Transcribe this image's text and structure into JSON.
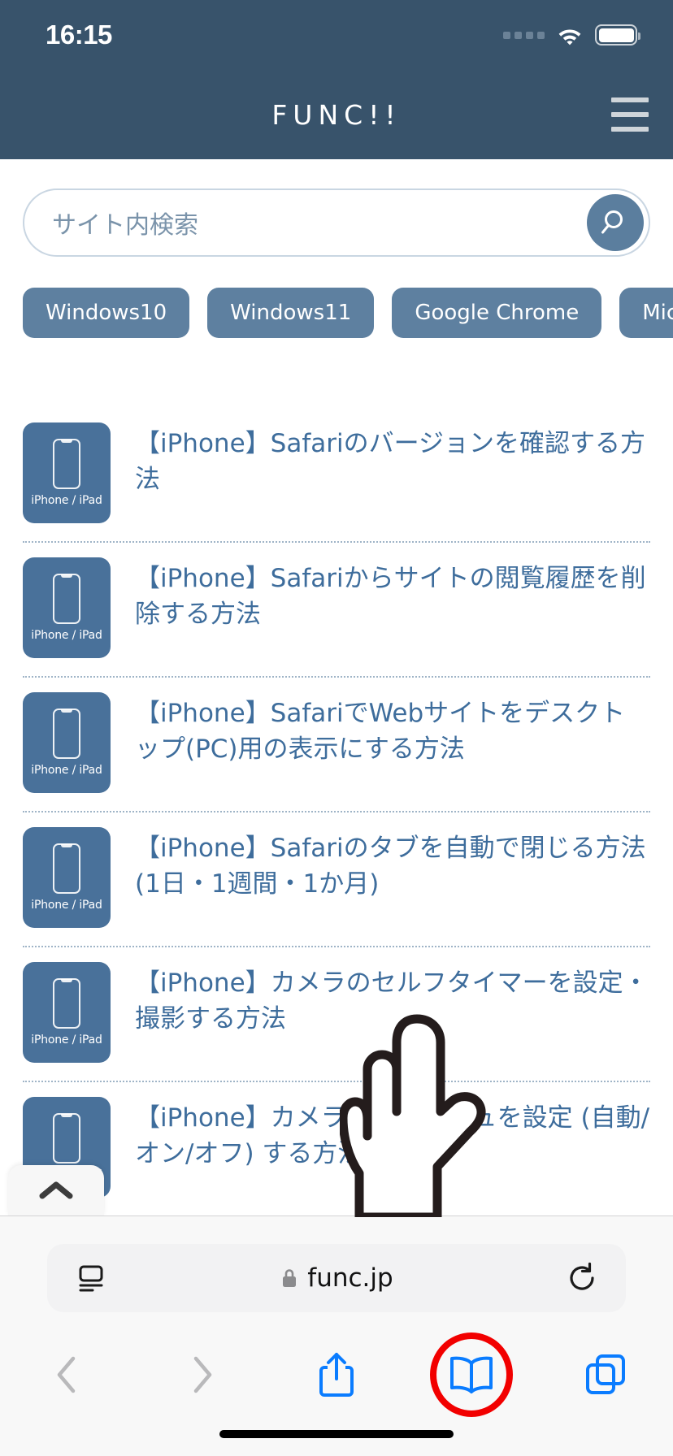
{
  "status_bar": {
    "time": "16:15",
    "signal_icon": "signal-dots-icon",
    "wifi_icon": "wifi-icon",
    "battery_icon": "battery-full-icon"
  },
  "site_header": {
    "logo": "FUNC!!",
    "menu_icon": "hamburger-menu-icon",
    "background_color": "#38536b"
  },
  "search": {
    "placeholder": "サイト内検索",
    "value": "",
    "button_icon": "search-icon"
  },
  "tags": [
    {
      "label": "Windows10"
    },
    {
      "label": "Windows11"
    },
    {
      "label": "Google Chrome"
    },
    {
      "label": "Micro"
    }
  ],
  "articles": [
    {
      "category": "iPhone / iPad",
      "title": "【iPhone】Safariのバージョンを確認する方法"
    },
    {
      "category": "iPhone / iPad",
      "title": "【iPhone】Safariからサイトの閲覧履歴を削除する方法"
    },
    {
      "category": "iPhone / iPad",
      "title": "【iPhone】SafariでWebサイトをデスクトップ(PC)用の表示にする方法"
    },
    {
      "category": "iPhone / iPad",
      "title": "【iPhone】Safariのタブを自動で閉じる方法 (1日・1週間・1か月)"
    },
    {
      "category": "iPhone / iPad",
      "title": "【iPhone】カメラのセルフタイマーを設定・撮影する方法"
    },
    {
      "category": "iPhone / iPad",
      "title": "【iPhone】カメラのフラッシュを設定 (自動/オン/オフ) する方法"
    }
  ],
  "scroll_to_top": {
    "icon": "chevron-up-icon"
  },
  "browser": {
    "url": "func.jp",
    "lock_icon": "lock-icon",
    "page_settings_icon": "aa-page-settings-icon",
    "reload_icon": "reload-icon",
    "back_icon": "chevron-left-icon",
    "forward_icon": "chevron-right-icon",
    "share_icon": "share-icon",
    "bookmarks_icon": "book-bookmarks-icon",
    "tabs_icon": "tabs-icon",
    "highlight_color": "#f20000",
    "accent_color": "#0a7cff"
  },
  "colors": {
    "header": "#38536b",
    "tag": "#5e80a0",
    "thumb": "#49719a",
    "title_link": "#3e6d9c"
  }
}
